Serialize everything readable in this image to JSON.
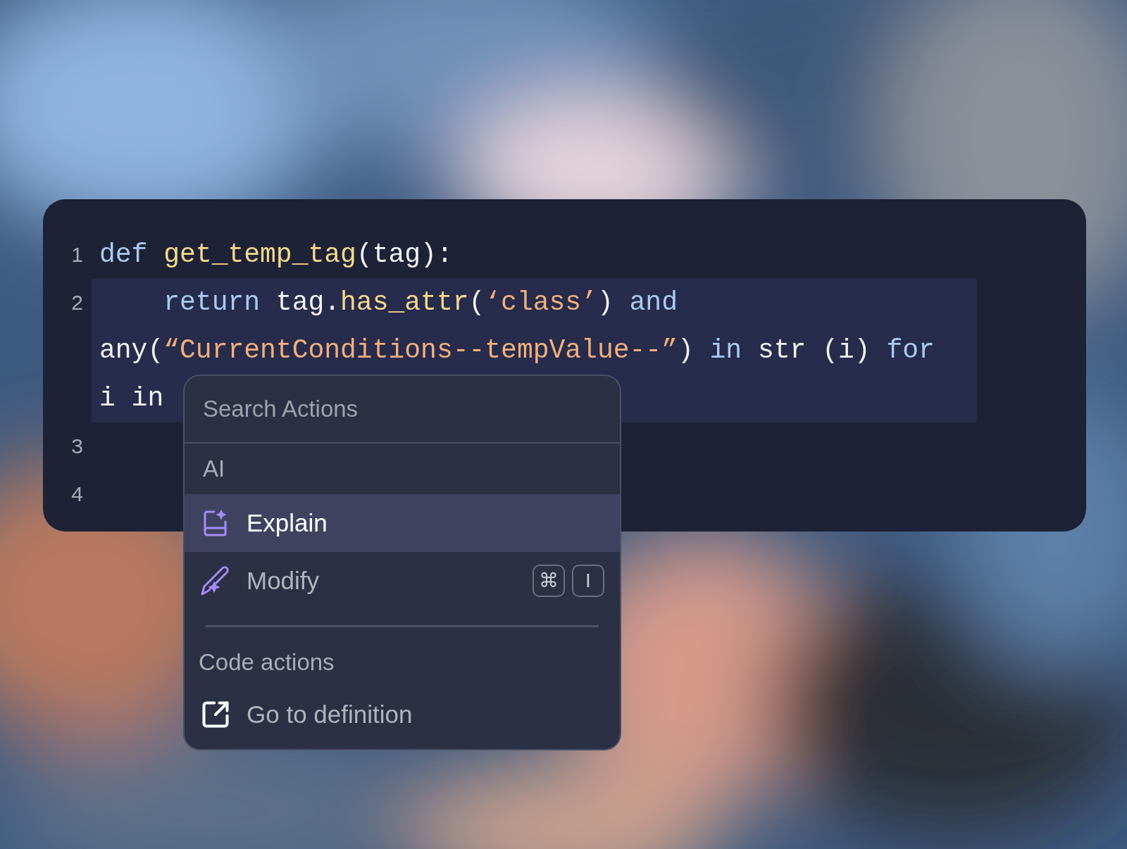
{
  "editor": {
    "lines": [
      {
        "number": "1",
        "selected": false,
        "wraps": [
          {
            "tokens": [
              {
                "kind": "keyword",
                "text": "def "
              },
              {
                "kind": "function",
                "text": "get_temp_tag"
              },
              {
                "kind": "plain",
                "text": "(tag):"
              }
            ]
          }
        ]
      },
      {
        "number": "2",
        "selected": true,
        "wraps": [
          {
            "tokens": [
              {
                "kind": "keyword",
                "text": "    return "
              },
              {
                "kind": "plain",
                "text": "tag."
              },
              {
                "kind": "function",
                "text": "has_attr"
              },
              {
                "kind": "plain",
                "text": "("
              },
              {
                "kind": "string",
                "text": "‘class’"
              },
              {
                "kind": "plain",
                "text": ") "
              },
              {
                "kind": "keyword",
                "text": "and"
              }
            ]
          },
          {
            "tokens": [
              {
                "kind": "plain",
                "text": "any("
              },
              {
                "kind": "string",
                "text": "“CurrentConditions--tempValue--”"
              },
              {
                "kind": "plain",
                "text": ") "
              },
              {
                "kind": "keyword",
                "text": "in "
              },
              {
                "kind": "plain",
                "text": "str (i) "
              },
              {
                "kind": "keyword",
                "text": "for"
              }
            ]
          },
          {
            "tokens": [
              {
                "kind": "plain",
                "text": "i in"
              }
            ]
          }
        ]
      },
      {
        "number": "3",
        "selected": false
      },
      {
        "number": "4",
        "selected": false
      }
    ]
  },
  "menu": {
    "search": {
      "placeholder": "Search Actions"
    },
    "sections": [
      {
        "title": "AI",
        "items": [
          {
            "label": "Explain",
            "kind": "explain",
            "selected": true
          },
          {
            "label": "Modify",
            "kind": "modify",
            "selected": false,
            "shortcut": [
              "⌘",
              "I"
            ]
          }
        ]
      },
      {
        "title": "Code actions",
        "items": [
          {
            "label": "Go to definition",
            "kind": "external",
            "selected": false
          }
        ]
      }
    ]
  }
}
